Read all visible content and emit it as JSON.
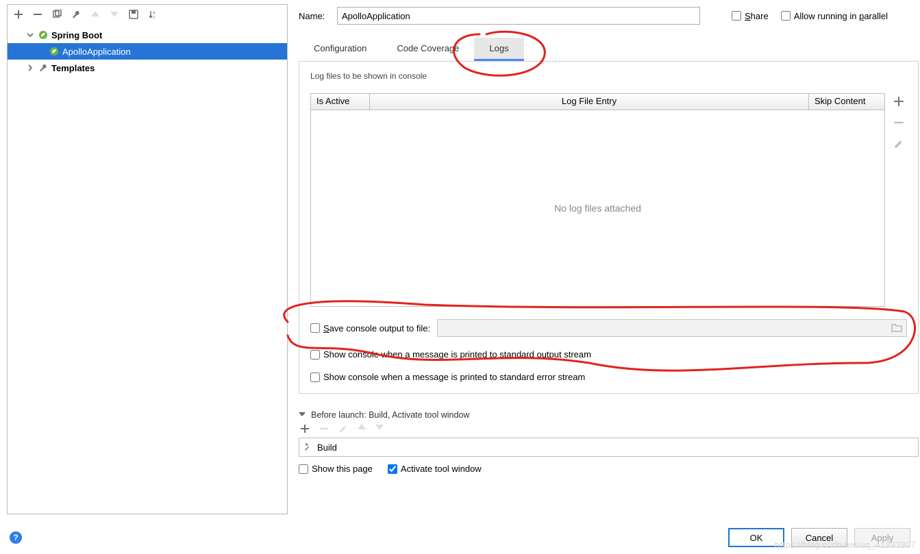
{
  "toolbar_icons": [
    "plus",
    "minus",
    "copy",
    "wrench",
    "up",
    "down",
    "save-all",
    "sort"
  ],
  "tree": {
    "spring_boot": "Spring Boot",
    "apollo": "ApolloApplication",
    "templates": "Templates"
  },
  "name_label": "Name:",
  "name_value": "ApolloApplication",
  "share_label_pre": "S",
  "share_label_rest": "hare",
  "parallel_label_pre": "Allow running in ",
  "parallel_label_u": "p",
  "parallel_label_post": "arallel",
  "tabs": {
    "config": "Configuration",
    "coverage": "Code Coverage",
    "logs": "Logs"
  },
  "logs": {
    "section": "Log files to be shown in console",
    "cols": {
      "active": "Is Active",
      "entry": "Log File Entry",
      "skip": "Skip Content"
    },
    "empty": "No log files attached",
    "save_pre": "S",
    "save_rest": "ave console output to file:",
    "stdout": "Show console when a message is printed to standard output stream",
    "stderr": "Show console when a message is printed to standard error stream"
  },
  "before": {
    "header": "Before launch: Build, Activate tool window",
    "item": "Build",
    "show_page": "Show this page",
    "activate": "Activate tool window"
  },
  "buttons": {
    "ok": "OK",
    "cancel": "Cancel",
    "apply": "Apply"
  },
  "watermark": "https://blog.csdn.net/qq_41933807"
}
